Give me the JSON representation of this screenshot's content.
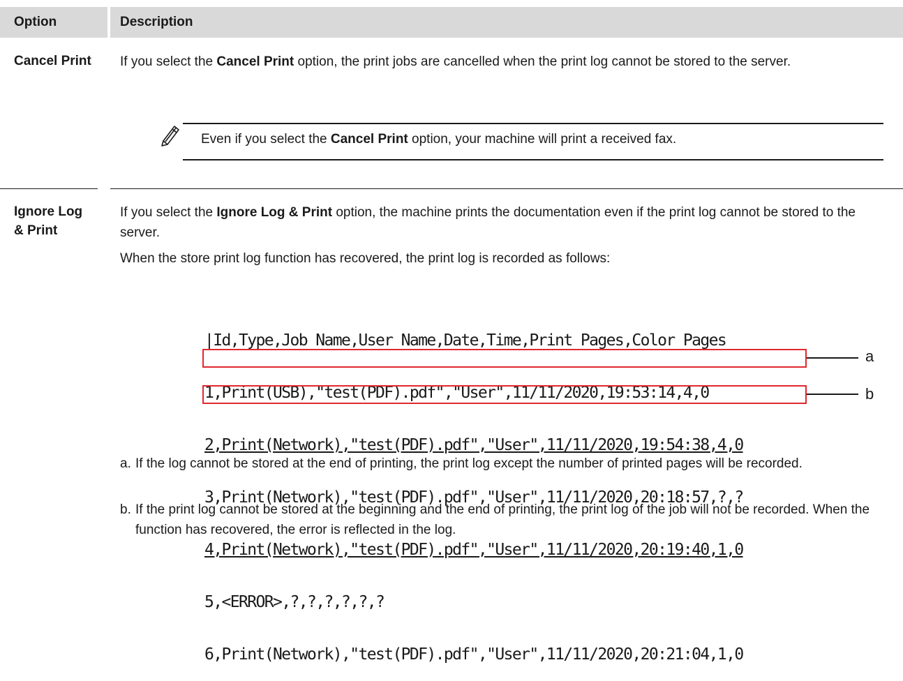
{
  "table": {
    "headers": {
      "option": "Option",
      "description": "Description"
    },
    "rows": [
      {
        "option": "Cancel Print",
        "description": {
          "pre": "If you select the ",
          "bold": "Cancel Print",
          "post": " option, the print jobs are cancelled when the print log cannot be stored to the server."
        },
        "note": {
          "icon": "pencil-icon",
          "pre": "Even if you select the ",
          "bold": "Cancel Print",
          "post": " option, your machine will print a received fax."
        }
      },
      {
        "option": "Ignore Log & Print",
        "description": {
          "pre": "If you select the ",
          "bold": "Ignore Log & Print",
          "post": " option, the machine prints the documentation even if the print log cannot be stored to the server."
        },
        "recovered_text": "When the store print log function has recovered, the print log is recorded as follows:",
        "log_lines": [
          "|Id,Type,Job Name,User Name,Date,Time,Print Pages,Color Pages",
          "1,Print(USB),\"test(PDF).pdf\",\"User\",11/11/2020,19:53:14,4,0",
          "2,Print(Network),\"test(PDF).pdf\",\"User\",11/11/2020,19:54:38,4,0",
          "3,Print(Network),\"test(PDF).pdf\",\"User\",11/11/2020,20:18:57,?,?",
          "4,Print(Network),\"test(PDF).pdf\",\"User\",11/11/2020,20:19:40,1,0",
          "5,<ERROR>,?,?,?,?,?,?",
          "6,Print(Network),\"test(PDF).pdf\",\"User\",11/11/2020,20:21:04,1,0"
        ],
        "callouts": {
          "a": "a",
          "b": "b"
        },
        "highlight_color": "#e0282e",
        "notes": [
          {
            "letter": "a.",
            "text": "If the log cannot be stored at the end of printing, the print log except the number of printed pages will be recorded."
          },
          {
            "letter": "b.",
            "text": "If the print log cannot be stored at the beginning and the end of printing, the print log of the job will not be recorded. When the function has recovered, the error is reflected in the log."
          }
        ]
      }
    ]
  }
}
